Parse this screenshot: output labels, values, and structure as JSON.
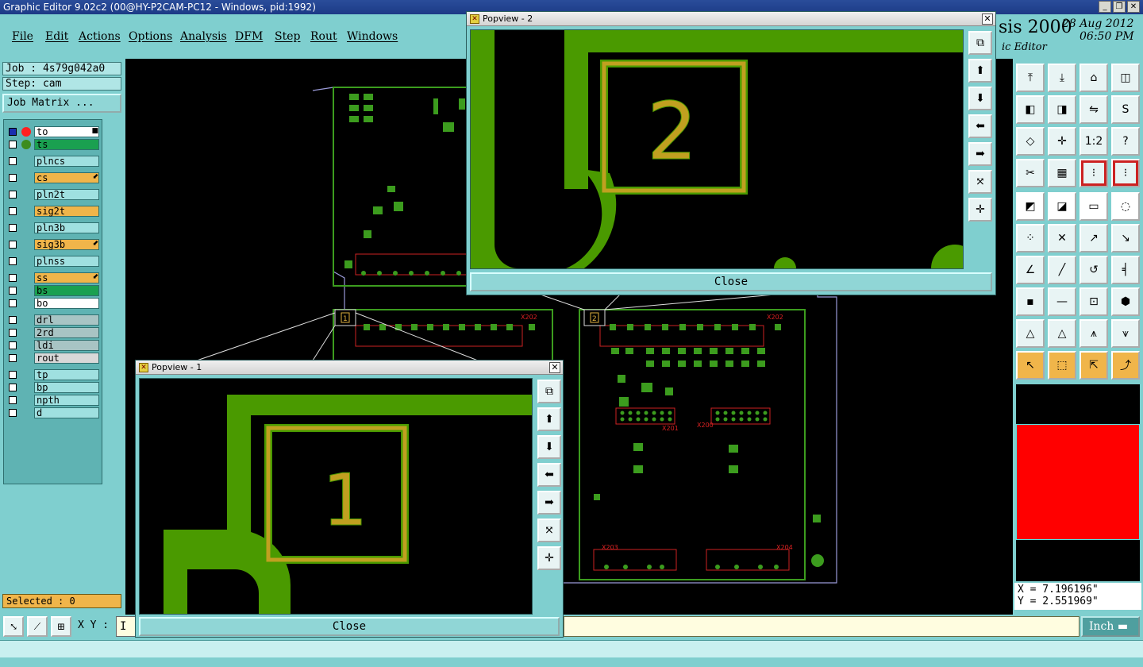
{
  "window": {
    "title": "Graphic Editor 9.02c2 (00@HY-P2CAM-PC12 - Windows, pid:1992)"
  },
  "menu": [
    "File",
    "Edit",
    "Actions",
    "Options",
    "Analysis",
    "DFM",
    "Step",
    "Rout",
    "Windows"
  ],
  "brand": {
    "name": "sis 2000",
    "subtitle": "ic Editor",
    "date": "28 Aug 2012",
    "time": "06:50 PM"
  },
  "job": {
    "job_label": "Job : 4s79g042a0",
    "step_label": "Step: cam",
    "matrix_button": "Job Matrix ..."
  },
  "layers": [
    {
      "name": "to",
      "color": "#ffffff",
      "dot": "#ff2020",
      "check": "#1a2fb0",
      "mark": "■"
    },
    {
      "name": "ts",
      "color": "#1aa050",
      "dot": "#3c8c1e",
      "check": "#ffffff",
      "mark": ""
    },
    {
      "name": "plncs",
      "color": "#9fe0e0",
      "dot": "",
      "check": "#ffffff",
      "mark": ""
    },
    {
      "name": "cs",
      "color": "#f0b54a",
      "dot": "",
      "check": "#ffffff",
      "mark": "⬋"
    },
    {
      "name": "pln2t",
      "color": "#9fe0e0",
      "dot": "",
      "check": "#ffffff",
      "mark": ""
    },
    {
      "name": "sig2t",
      "color": "#f0b54a",
      "dot": "",
      "check": "#ffffff",
      "mark": ""
    },
    {
      "name": "pln3b",
      "color": "#9fe0e0",
      "dot": "",
      "check": "#ffffff",
      "mark": ""
    },
    {
      "name": "sig3b",
      "color": "#f0b54a",
      "dot": "",
      "check": "#ffffff",
      "mark": "⬋"
    },
    {
      "name": "plnss",
      "color": "#9fe0e0",
      "dot": "",
      "check": "#ffffff",
      "mark": ""
    },
    {
      "name": "ss",
      "color": "#f0b54a",
      "dot": "",
      "check": "#ffffff",
      "mark": "⬋"
    },
    {
      "name": "bs",
      "color": "#1aa050",
      "dot": "",
      "check": "#ffffff",
      "mark": ""
    },
    {
      "name": "bo",
      "color": "#ffffff",
      "dot": "",
      "check": "#ffffff",
      "mark": ""
    },
    {
      "name": "drl",
      "color": "#a8c4c4",
      "dot": "",
      "check": "#ffffff",
      "mark": ""
    },
    {
      "name": "2rd",
      "color": "#a8c4c4",
      "dot": "",
      "check": "#ffffff",
      "mark": ""
    },
    {
      "name": "ldi",
      "color": "#a8c4c4",
      "dot": "",
      "check": "#ffffff",
      "mark": ""
    },
    {
      "name": "rout",
      "color": "#d8d8d8",
      "dot": "",
      "check": "#ffffff",
      "mark": ""
    },
    {
      "name": "tp",
      "color": "#9fe0e0",
      "dot": "",
      "check": "#ffffff",
      "mark": ""
    },
    {
      "name": "bp",
      "color": "#9fe0e0",
      "dot": "",
      "check": "#ffffff",
      "mark": ""
    },
    {
      "name": "npth",
      "color": "#9fe0e0",
      "dot": "",
      "check": "#ffffff",
      "mark": ""
    },
    {
      "name": "d",
      "color": "#9fe0e0",
      "dot": "",
      "check": "#ffffff",
      "mark": ""
    }
  ],
  "selected_label": "Selected : 0",
  "board_labels": {
    "x202_a": "X202",
    "x202_b": "X202",
    "x201": "X201",
    "x200": "X200",
    "x203": "X203",
    "x204": "X204",
    "marker1": "1",
    "marker2": "2"
  },
  "popview1": {
    "title": "Popview - 1",
    "digit": "1",
    "close_label": "Close"
  },
  "popview2": {
    "title": "Popview - 2",
    "digit": "2",
    "close_label": "Close"
  },
  "tool_icons": [
    "zoom-up-icon",
    "zoom-down-icon",
    "home-icon",
    "split-icon",
    "pan-left-icon",
    "pan-right-icon",
    "reverse-icon",
    "s-curve-icon",
    "fit-icon",
    "center-icon",
    "scale-1-2-icon",
    "help-icon",
    "measure-icon",
    "grid-icon",
    "layer-red-icon",
    "layer-red2-icon",
    "pad-icon",
    "polygon-icon",
    "ruler-icon",
    "dotted-circle-icon",
    "nodes-icon",
    "cross-node-icon",
    "line-add-icon",
    "line-edit-icon",
    "angle-icon",
    "slash-icon",
    "arc-icon",
    "split-shape-icon",
    "pad-red-icon",
    "line-red-icon",
    "dimension-icon",
    "blob-icon",
    "triangle-icon",
    "triangle2-icon",
    "triangle3-icon",
    "triangle4-icon",
    "pointer-icon",
    "select-box-icon",
    "select-cursor-icon",
    "route-icon"
  ],
  "tool_labels": {
    "scale": "1:2",
    "help": "?"
  },
  "coords": {
    "x": "X = 7.196196\"",
    "y": "Y = 2.551969\""
  },
  "bottom": {
    "xy_label": "X Y :",
    "xy_value": "I",
    "unit": "Inch"
  }
}
